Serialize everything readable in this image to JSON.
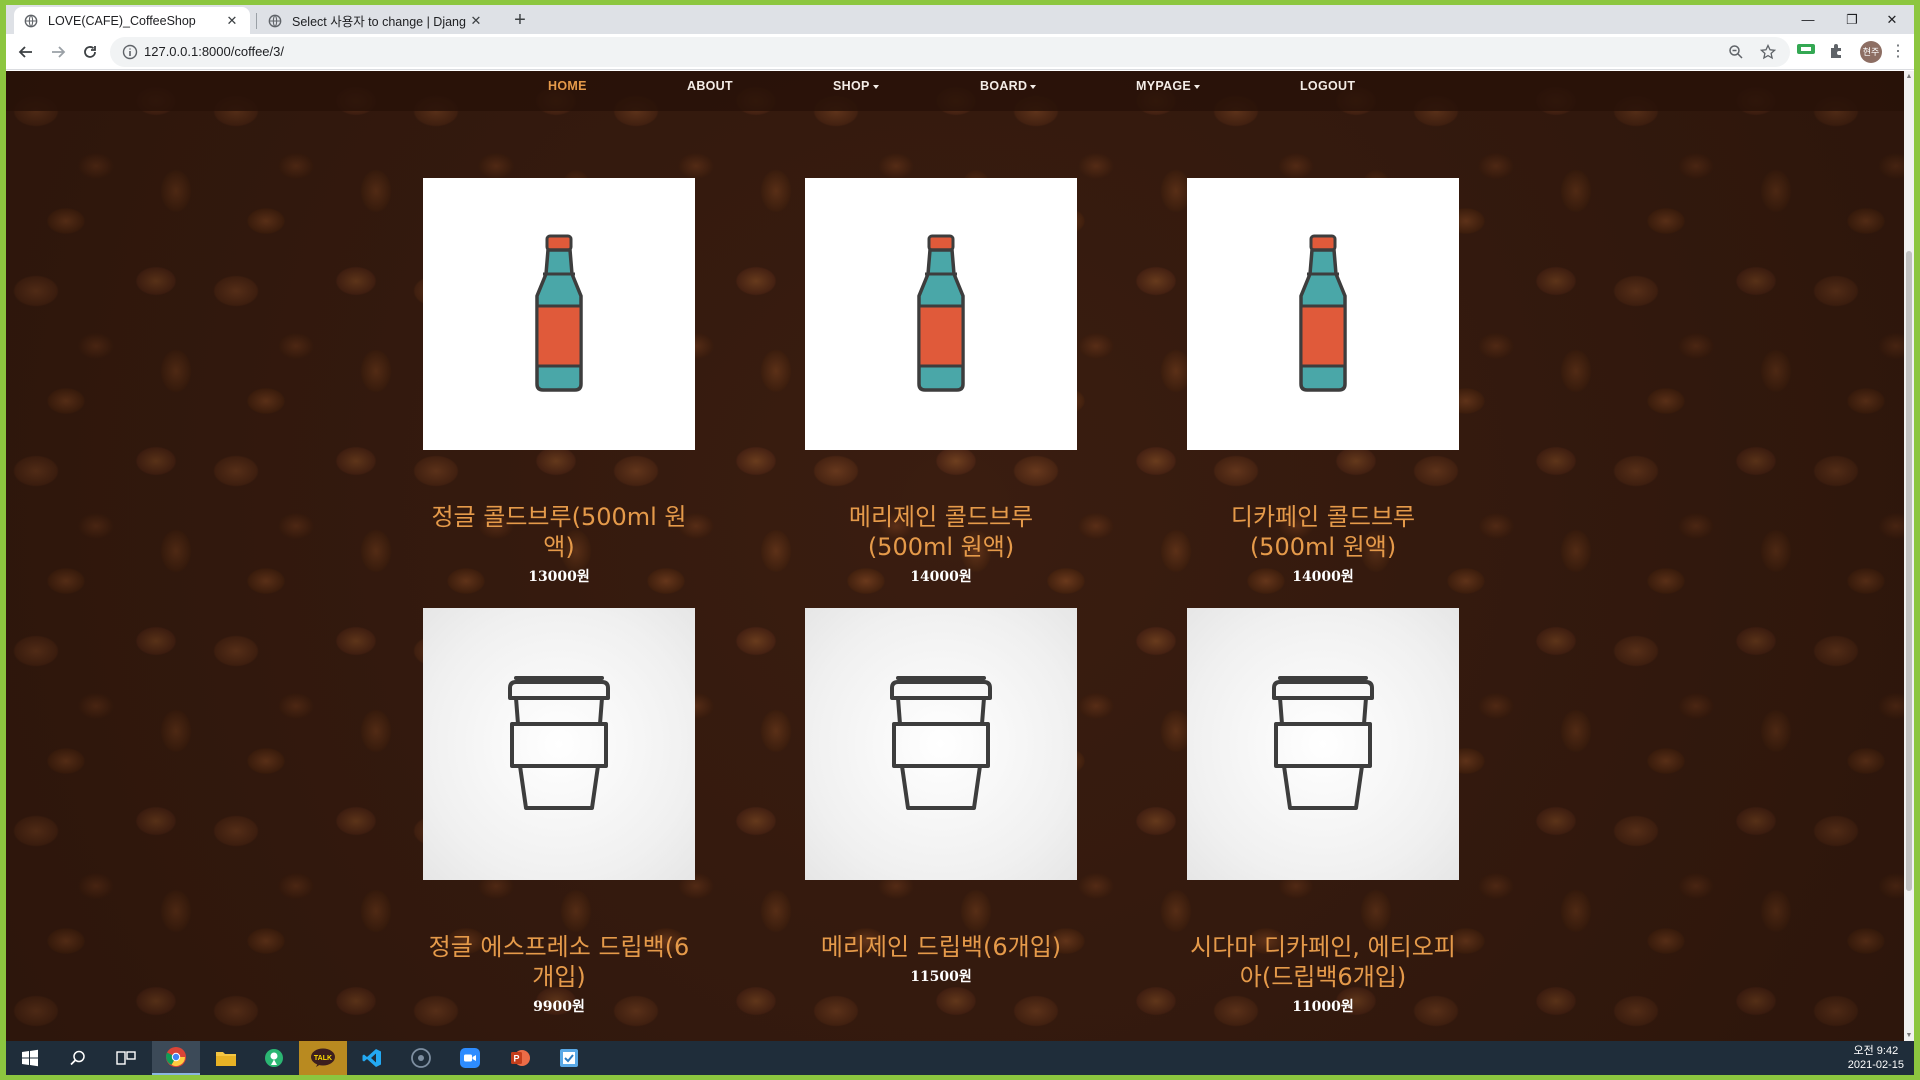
{
  "browser": {
    "tabs": [
      {
        "title": "LOVE(CAFE)_CoffeeShop",
        "active": true
      },
      {
        "title": "Select 사용자 to change | Djang",
        "active": false
      }
    ],
    "new_tab": "+",
    "url": "127.0.0.1:8000/coffee/3/",
    "profile_initial": "현주"
  },
  "site_nav": {
    "items": [
      {
        "label": "HOME",
        "current": true,
        "dropdown": false
      },
      {
        "label": "ABOUT",
        "current": false,
        "dropdown": false
      },
      {
        "label": "SHOP",
        "current": false,
        "dropdown": true
      },
      {
        "label": "BOARD",
        "current": false,
        "dropdown": true
      },
      {
        "label": "MYPAGE",
        "current": false,
        "dropdown": true
      },
      {
        "label": "LOGOUT",
        "current": false,
        "dropdown": false
      }
    ]
  },
  "products": [
    {
      "name": "정글 콜드브루(500ml 원액)",
      "price": "13000원",
      "icon": "bottle-icon"
    },
    {
      "name": "메리제인 콜드브루(500ml 원액)",
      "price": "14000원",
      "icon": "bottle-icon"
    },
    {
      "name": "디카페인 콜드브루(500ml 원액)",
      "price": "14000원",
      "icon": "bottle-icon"
    },
    {
      "name": "정글 에스프레소 드립백(6개입)",
      "price": "9900원",
      "icon": "cup-icon"
    },
    {
      "name": "메리제인 드립백(6개입)",
      "price": "11500원",
      "icon": "cup-icon"
    },
    {
      "name": "시다마 디카페인, 에티오피아(드립백6개입)",
      "price": "11000원",
      "icon": "cup-icon"
    }
  ],
  "colors": {
    "accent": "#e59a4a",
    "bottle_body": "#e05a3a",
    "bottle_glass": "#4aa7a8",
    "outline": "#3d3d3d"
  },
  "taskbar": {
    "apps": [
      "start-icon",
      "search-icon",
      "task-view-icon",
      "chrome-icon",
      "file-explorer-icon",
      "maps-icon",
      "kakaotalk-icon",
      "vscode-icon",
      "app-icon",
      "zoom-icon",
      "powerpoint-icon",
      "app-icon"
    ],
    "kakao_label": "TALK",
    "clock_time": "오전 9:42",
    "clock_date": "2021-02-15"
  }
}
